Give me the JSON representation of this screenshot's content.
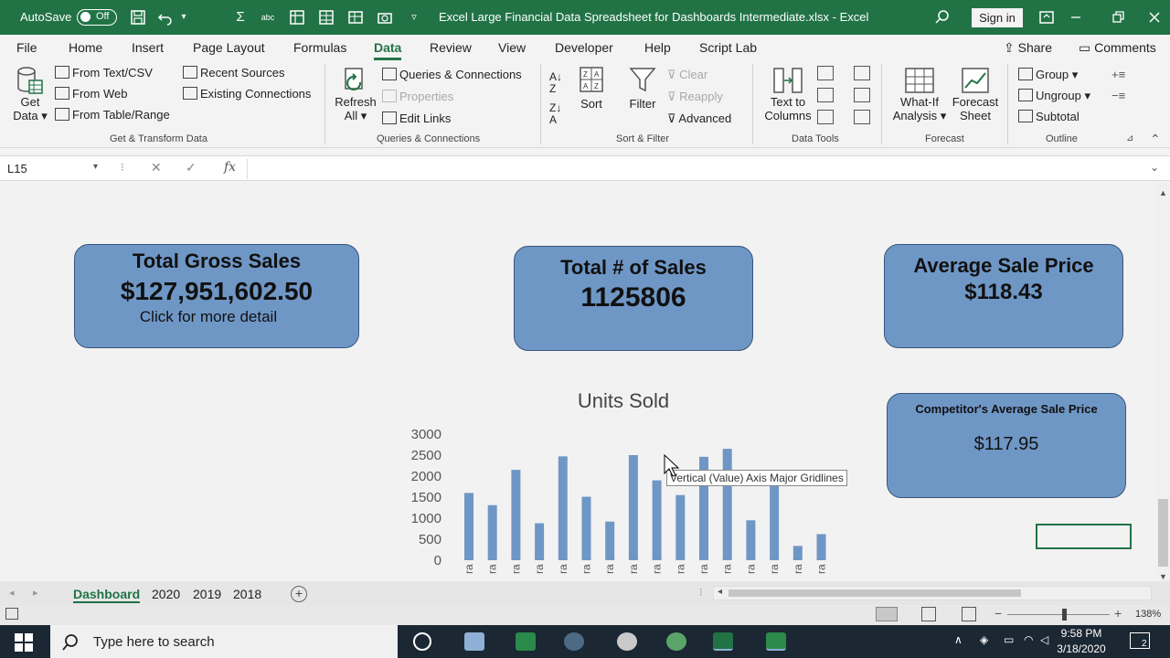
{
  "titlebar": {
    "autosave_label": "AutoSave",
    "autosave_state": "Off",
    "title": "Excel Large Financial Data Spreadsheet for Dashboards Intermediate.xlsx  -  Excel",
    "signin": "Sign in"
  },
  "tabs": [
    "File",
    "Home",
    "Insert",
    "Page Layout",
    "Formulas",
    "Data",
    "Review",
    "View",
    "Developer",
    "Help",
    "Script Lab"
  ],
  "active_tab": "Data",
  "share": "Share",
  "comments": "Comments",
  "ribbon": {
    "get_data": "Get",
    "get_data2": "Data",
    "from_text_csv": "From Text/CSV",
    "from_web": "From Web",
    "from_table": "From Table/Range",
    "recent_sources": "Recent Sources",
    "existing_connections": "Existing Connections",
    "group_get_transform": "Get & Transform Data",
    "refresh": "Refresh",
    "refresh2": "All",
    "queries_connections": "Queries & Connections",
    "properties": "Properties",
    "edit_links": "Edit Links",
    "group_queries": "Queries & Connections",
    "sort": "Sort",
    "filter": "Filter",
    "clear": "Clear",
    "reapply": "Reapply",
    "advanced": "Advanced",
    "group_sort_filter": "Sort & Filter",
    "text_to_columns": "Text to",
    "text_to_columns2": "Columns",
    "group_data_tools": "Data Tools",
    "whatif": "What-If",
    "whatif2": "Analysis",
    "forecast_sheet": "Forecast",
    "forecast_sheet2": "Sheet",
    "group_forecast": "Forecast",
    "group": "Group",
    "ungroup": "Ungroup",
    "subtotal": "Subtotal",
    "group_outline": "Outline"
  },
  "formula_bar": {
    "name_box": "L15",
    "fx": "fx"
  },
  "cards": {
    "gross_sales_title": "Total Gross Sales",
    "gross_sales_value": "$127,951,602.50",
    "gross_sales_link": "Click for more detail",
    "num_sales_title": "Total # of Sales",
    "num_sales_value": "1125806",
    "avg_price_title": "Average Sale Price",
    "avg_price_value": "$118.43",
    "competitor_title": "Competitor's Average Sale Price",
    "competitor_value": "$117.95"
  },
  "tooltip": "Vertical (Value) Axis Major Gridlines",
  "chart_data": {
    "type": "bar",
    "title": "Units Sold",
    "ylim": [
      0,
      3000
    ],
    "yticks": [
      "3000",
      "2500",
      "2000",
      "1500",
      "1000",
      "500",
      "0"
    ],
    "categories": [
      "ra",
      "ra",
      "ra",
      "ra",
      "ra",
      "ra",
      "ra",
      "ra",
      "ra",
      "ra",
      "ra",
      "ra",
      "ra",
      "ra",
      "ra",
      "ra"
    ],
    "values": [
      1600,
      1310,
      2150,
      880,
      2470,
      1510,
      920,
      2500,
      1900,
      1550,
      2460,
      2650,
      950,
      1810,
      340,
      620
    ],
    "color": "#6f97c6",
    "grid": false,
    "legend": "none"
  },
  "sheet_tabs": [
    "Dashboard",
    "2020",
    "2019",
    "2018"
  ],
  "active_sheet": "Dashboard",
  "zoom": "138%",
  "taskbar": {
    "search_placeholder": "Type here to search",
    "time": "9:58 PM",
    "date": "3/18/2020",
    "notifications": "2"
  }
}
